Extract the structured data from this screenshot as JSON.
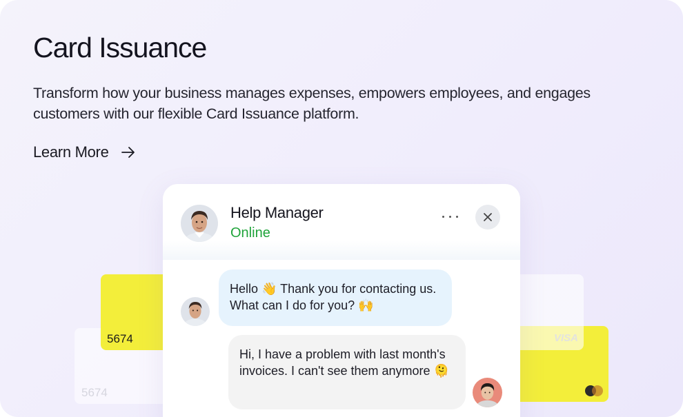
{
  "section": {
    "title": "Card Issuance",
    "description": "Transform how your business manages expenses, empowers employees, and engages customers with our flexible Card Issuance platform.",
    "link_label": "Learn More"
  },
  "cards": {
    "left_number": "5674",
    "left_back_number": "5674",
    "right_brand": "VISA"
  },
  "chat": {
    "agent_name": "Help Manager",
    "agent_status": "Online",
    "messages": [
      {
        "from": "agent",
        "text": "Hello 👋 Thank you for contacting us. What can I do for you? 🙌"
      },
      {
        "from": "user",
        "text": "Hi, I have a problem with last month's invoices. I can't see them anymore 🫠"
      }
    ]
  },
  "colors": {
    "status_online": "#1fa33a",
    "card_yellow": "#f3ee3a",
    "agent_bubble": "#e6f3fd",
    "user_bubble": "#f3f3f3"
  },
  "icons": [
    "arrow-right-icon",
    "more-icon",
    "close-icon"
  ]
}
